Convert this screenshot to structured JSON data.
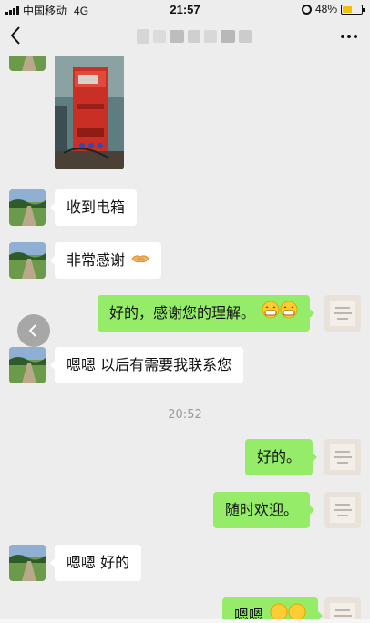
{
  "status_bar": {
    "carrier": "中国移动",
    "network": "4G",
    "time": "21:57",
    "battery": "48%",
    "battery_level": 0.48
  },
  "nav": {
    "back_icon": "chevron-left-icon",
    "more_icon": "more-dots-icon"
  },
  "messages": [
    {
      "side": "in",
      "type": "image"
    },
    {
      "side": "in",
      "type": "text",
      "text": "收到电箱"
    },
    {
      "side": "in",
      "type": "text",
      "text": "非常感谢",
      "emoji": "handshake-emoji"
    },
    {
      "side": "out",
      "type": "text",
      "text": "好的，感谢您的理解。",
      "emoji": "grin-emoji x2"
    },
    {
      "side": "in",
      "type": "text",
      "text": "嗯嗯 以后有需要我联系您"
    },
    {
      "type": "time",
      "text": "20:52"
    },
    {
      "side": "out",
      "type": "text",
      "text": "好的。"
    },
    {
      "side": "out",
      "type": "text",
      "text": "随时欢迎。"
    },
    {
      "side": "in",
      "type": "text",
      "text": "嗯嗯 好的"
    },
    {
      "side": "out",
      "type": "text",
      "text": "嗯嗯"
    }
  ],
  "colors": {
    "background": "#ededed",
    "incoming_bubble": "#ffffff",
    "outgoing_bubble": "#95ec69",
    "timestamp": "#9a9a9a"
  }
}
